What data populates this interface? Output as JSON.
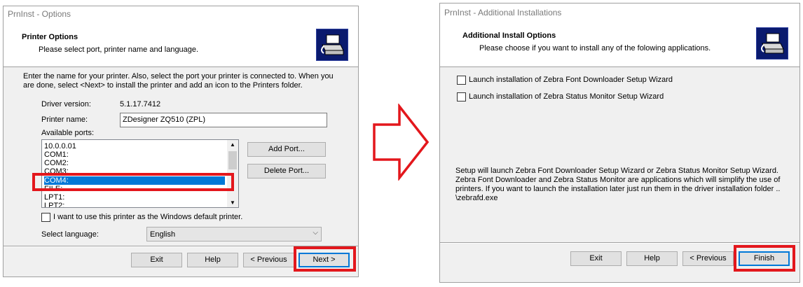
{
  "left_window": {
    "title": "PrnInst - Options",
    "header_title": "Printer Options",
    "header_subtitle": "Please select port, printer name and language.",
    "instructions": "Enter the name for your printer. Also, select the port your printer is connected to. When you are done, select <Next> to install the printer and add an icon to the Printers folder.",
    "driver_version_label": "Driver version:",
    "driver_version_value": "5.1.17.7412",
    "printer_name_label": "Printer name:",
    "printer_name_value": "ZDesigner ZQ510 (ZPL)",
    "available_ports_label": "Available ports:",
    "ports": [
      "10.0.0.01",
      "COM1:",
      "COM2:",
      "COM3:",
      "COM4:",
      "FILE:",
      "LPT1:",
      "LPT2:"
    ],
    "selected_port": "COM4:",
    "add_port_label": "Add Port...",
    "delete_port_label": "Delete Port...",
    "default_printer_label": "I want to use this printer as the Windows default printer.",
    "select_language_label": "Select language:",
    "language_value": "English",
    "buttons": {
      "exit": "Exit",
      "help": "Help",
      "previous": "< Previous",
      "next": "Next >"
    }
  },
  "right_window": {
    "title": "PrnInst - Additional Installations",
    "header_title": "Additional Install Options",
    "header_subtitle": "Please choose if you want to install any of the folowing applications.",
    "option1_label": "Launch installation of Zebra Font Downloader Setup Wizard",
    "option2_label": "Launch installation of Zebra Status Monitor Setup Wizard",
    "info_text_1": "Setup will launch Zebra Font Downloader Setup Wizard or Zebra Status Monitor Setup Wizard.",
    "info_text_2": "Zebra Font Downloader and Zebra Status Monitor are applications which will simplify the use of",
    "info_text_3": "printers. If you want to launch the installation later just run them in the driver installation folder ..",
    "info_text_4": "\\zebrafd.exe",
    "buttons": {
      "exit": "Exit",
      "help": "Help",
      "previous": "< Previous",
      "finish": "Finish"
    }
  },
  "colors": {
    "highlight": "#e3171c",
    "selection": "#0078d7",
    "logo_bg": "#0a1a6e"
  }
}
